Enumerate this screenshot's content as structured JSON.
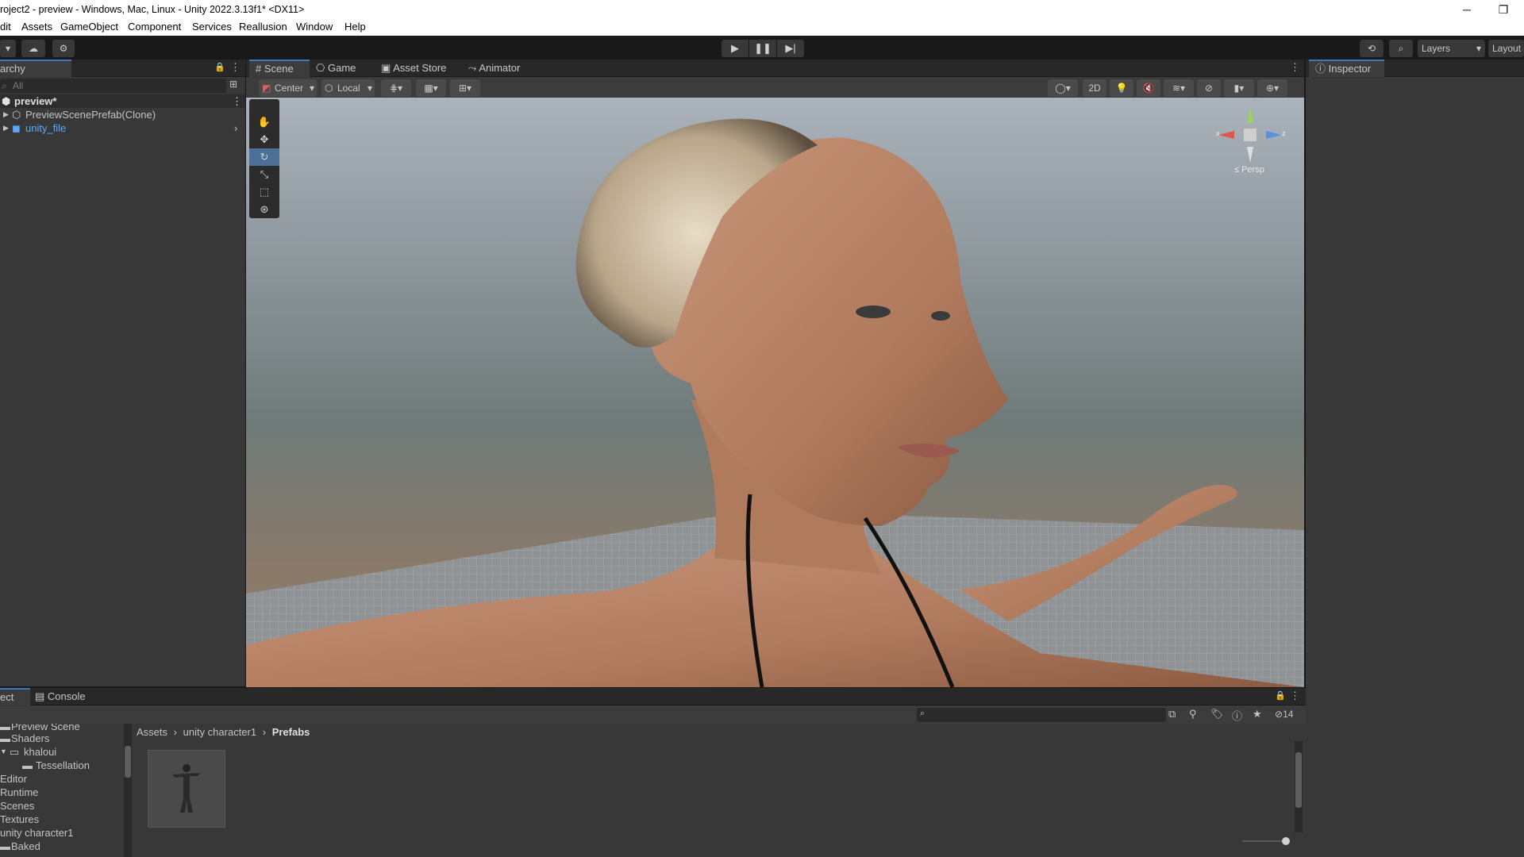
{
  "window": {
    "title": "roject2 - preview - Windows, Mac, Linux - Unity 2022.3.13f1* <DX11>",
    "minimize": "─",
    "restore": "❐"
  },
  "menu": [
    "dit",
    "Assets",
    "GameObject",
    "Component",
    "Services",
    "Reallusion",
    "Window",
    "Help"
  ],
  "toolbar": {
    "layers_label": "Layers",
    "layout_label": "Layout"
  },
  "hierarchy": {
    "tab_label": "archy",
    "search_placeholder": "All",
    "scene_name": "preview*",
    "items": [
      {
        "label": "PreviewScenePrefab(Clone)"
      },
      {
        "label": "unity_file"
      }
    ]
  },
  "scene_tabs": [
    "Scene",
    "Game",
    "Asset Store",
    "Animator"
  ],
  "scene_toolbar": {
    "pivot": "Center",
    "space": "Local",
    "mode_2d": "2D"
  },
  "gizmo": {
    "x": "x",
    "z": "z",
    "persp": "≤ Persp"
  },
  "inspector": {
    "tab_label": "Inspector"
  },
  "bottom": {
    "tabs": [
      "ect",
      "Console"
    ],
    "breadcrumb": [
      "Assets",
      "unity character1",
      "Prefabs"
    ],
    "hidden_count": "14",
    "tree": [
      {
        "label": "Preview Scene"
      },
      {
        "label": "Shaders"
      },
      {
        "label": "khaloui"
      },
      {
        "label": "Tessellation"
      },
      {
        "label": "Editor"
      },
      {
        "label": "Runtime"
      },
      {
        "label": "Scenes"
      },
      {
        "label": "Textures"
      },
      {
        "label": "unity character1"
      },
      {
        "label": "Baked"
      }
    ]
  },
  "colors": {
    "accent": "#3a79bb",
    "link": "#5aa8ff",
    "panel": "#383838",
    "header": "#282828"
  }
}
